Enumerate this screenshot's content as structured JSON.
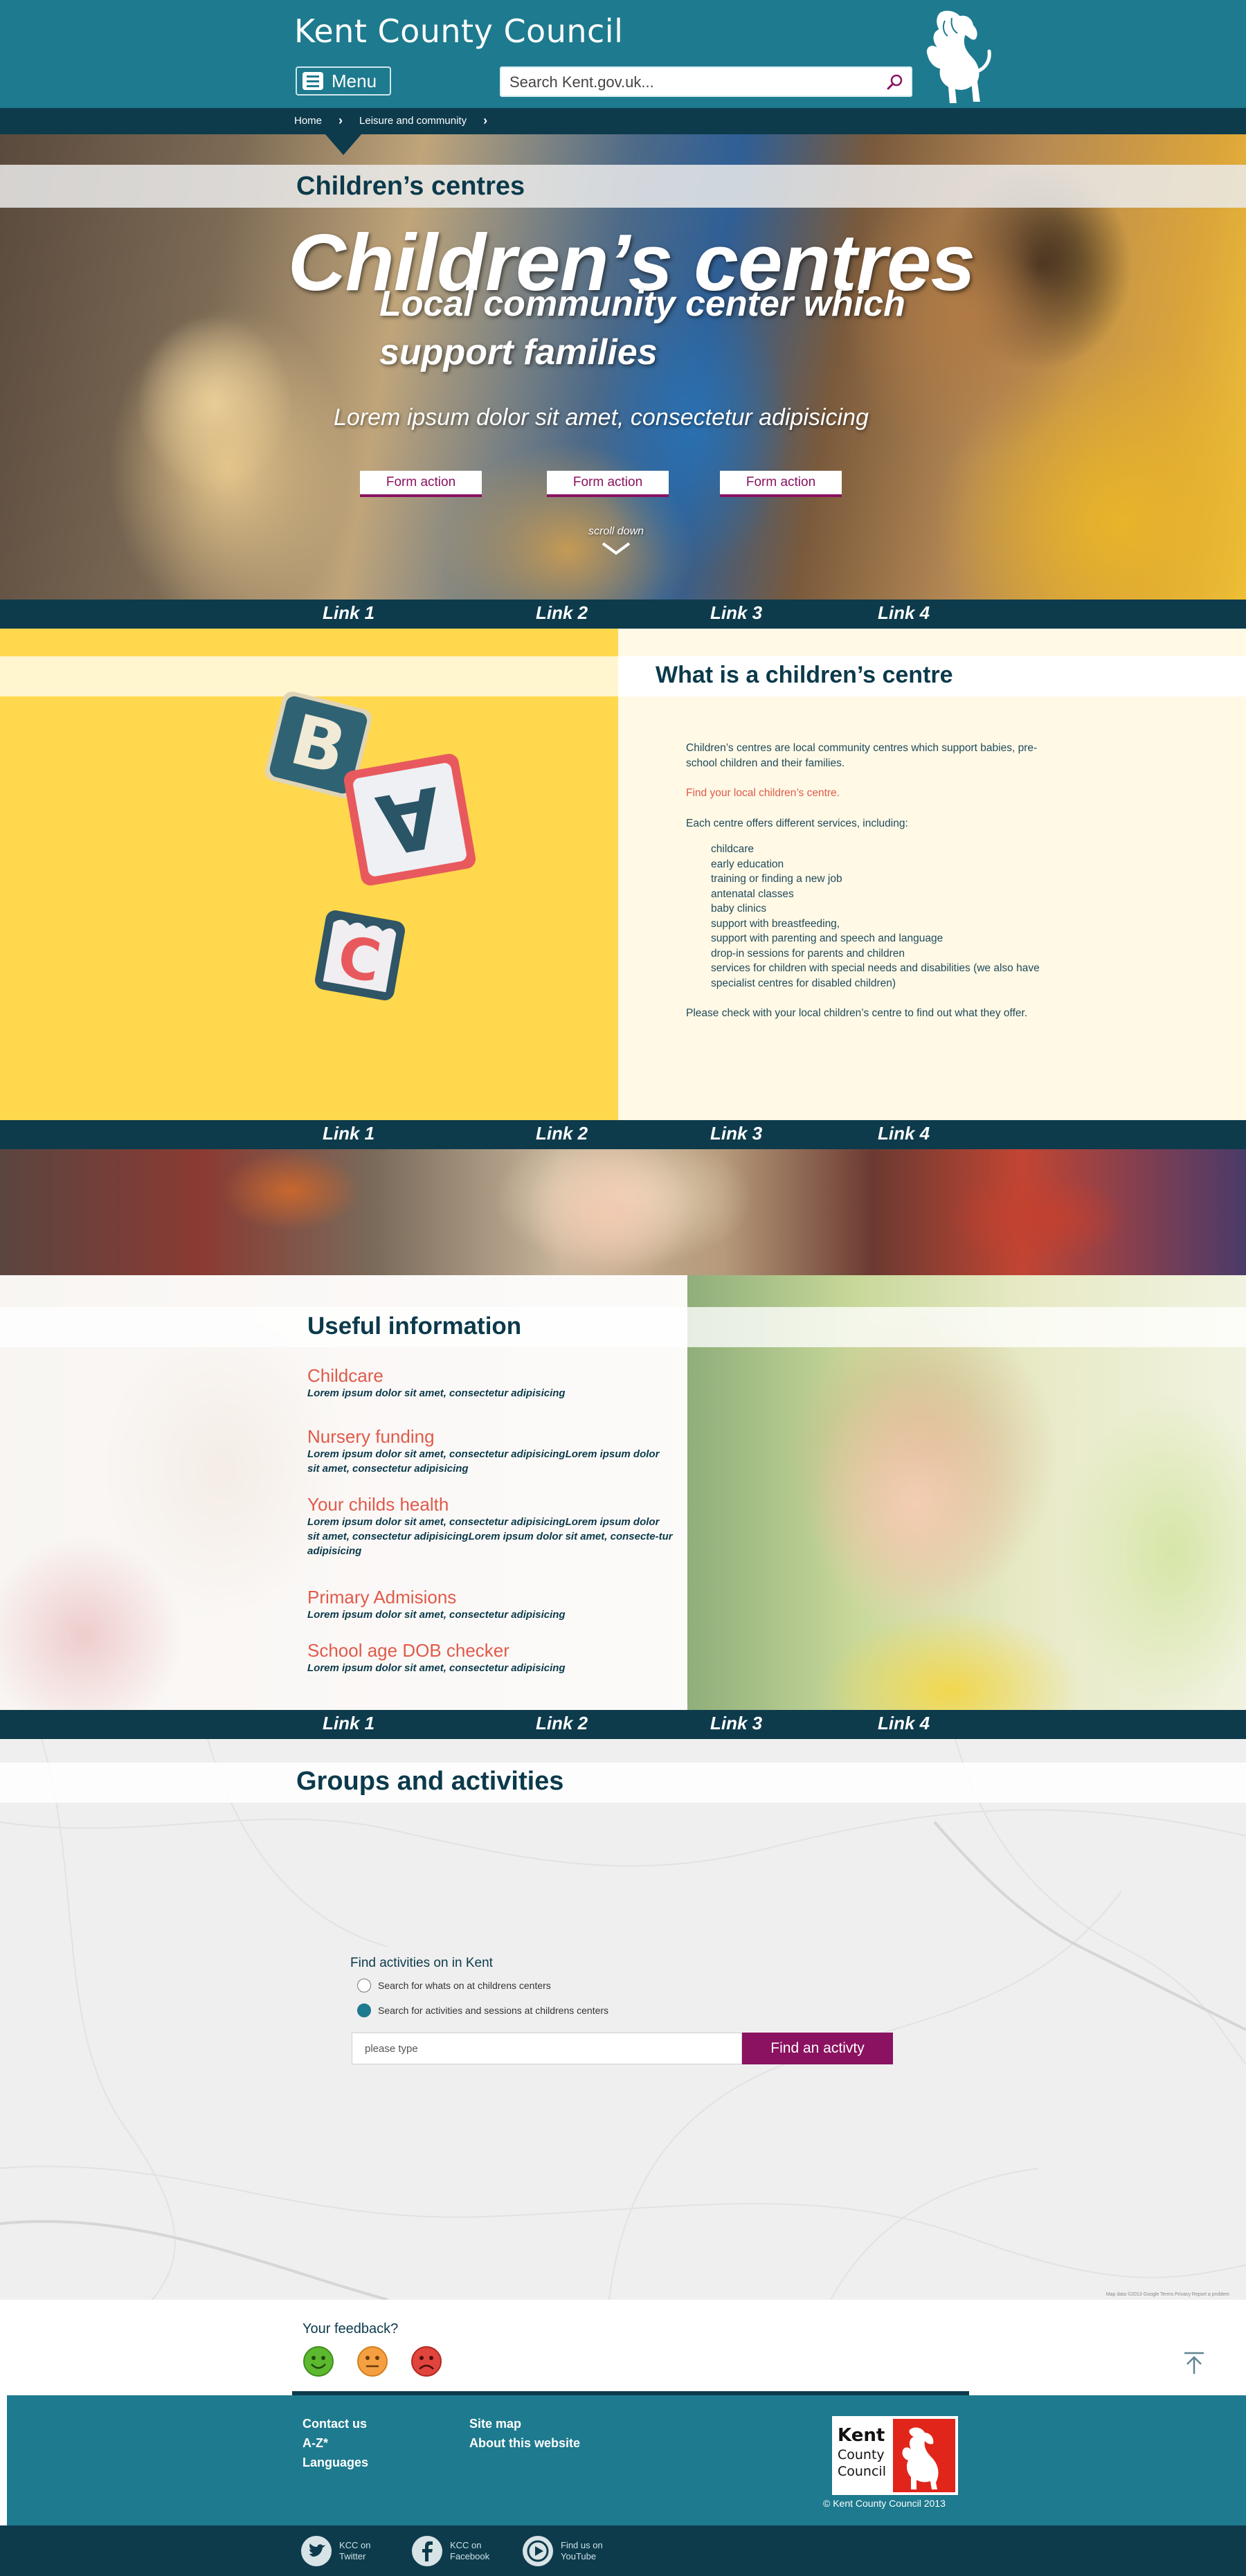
{
  "header": {
    "site_title": "Kent County Council",
    "menu_label": "Menu",
    "search_placeholder": "Search Kent.gov.uk..."
  },
  "breadcrumb": [
    "Home",
    "Leisure and community"
  ],
  "hero": {
    "band_title": "Children’s centres",
    "heading": "Children’s centres",
    "subheading": "Local community center which support families",
    "lorem": "Lorem ipsum dolor sit amet, consectetur adipisicing",
    "actions": [
      "Form action",
      "Form action",
      "Form action"
    ],
    "scroll_label": "scroll down"
  },
  "link_bar": [
    "Link 1",
    "Link 2",
    "Link 3",
    "Link 4"
  ],
  "what_is": {
    "heading": "What is a children’s centre",
    "intro": "Children’s centres are local community centres which support babies, pre-school children and their families.",
    "link": "Find your local children’s centre.",
    "services_intro": "Each centre offers different services, including:",
    "services": [
      "childcare",
      "early education",
      "training or finding a new job",
      "antenatal classes",
      "baby clinics",
      "support with breastfeeding,",
      "support with parenting and speech and language",
      "drop-in sessions for parents and children",
      "services for children with special needs and disabilities (we also have specialist centres for disabled children)"
    ],
    "outro": "Please check with your local children’s centre to find out what they offer.",
    "blocks": [
      "B",
      "A",
      "C"
    ]
  },
  "useful": {
    "heading": "Useful information",
    "items": [
      {
        "title": "Childcare",
        "desc": "Lorem ipsum dolor sit amet, consectetur adipisicing"
      },
      {
        "title": "Nursery funding",
        "desc": "Lorem ipsum dolor sit amet, consectetur adipisicingLorem ipsum dolor sit amet, consectetur adipisicing"
      },
      {
        "title": "Your childs health",
        "desc": "Lorem ipsum dolor sit amet, consectetur adipisicingLorem ipsum dolor sit amet, consectetur adipisicingLorem ipsum dolor sit amet, consecte-tur adipisicing"
      },
      {
        "title": "Primary Admisions",
        "desc": "Lorem ipsum dolor sit amet, consectetur adipisicing"
      },
      {
        "title": "School age DOB checker",
        "desc": "Lorem ipsum dolor sit amet, consectetur adipisicing"
      }
    ]
  },
  "groups": {
    "heading": "Groups and activities",
    "find_title": "Find activities on in Kent",
    "radio_options": [
      {
        "label": "Search for whats on at childrens centers",
        "selected": false
      },
      {
        "label": "Search for activities and sessions at childrens centers",
        "selected": true
      }
    ],
    "input_placeholder": "please type",
    "button_label": "Find an activty",
    "map_attribution": "Map data ©2013 Google   Terms   Privacy   Report a problem"
  },
  "feedback": {
    "label": "Your feedback?",
    "faces": [
      "happy",
      "neutral",
      "sad"
    ],
    "colors": {
      "happy": "#5cb82e",
      "neutral": "#f4a041",
      "sad": "#e0443c"
    }
  },
  "footer": {
    "col1": [
      "Contact us",
      "A-Z*",
      "Languages"
    ],
    "col2": [
      "Site map",
      "About this website"
    ],
    "logo_text": [
      "Kent",
      "County",
      "Council"
    ],
    "copyright": "© Kent County Council 2013",
    "social": [
      {
        "icon": "twitter-icon",
        "line1": "KCC on",
        "line2": "Twitter"
      },
      {
        "icon": "facebook-icon",
        "line1": "KCC on",
        "line2": "Facebook"
      },
      {
        "icon": "youtube-icon",
        "line1": "Find us on",
        "line2": "YouTube"
      }
    ]
  },
  "colors": {
    "primary": "#1e7a8e",
    "dark": "#0d3b4c",
    "accent": "#8a1260",
    "link": "#e05a4a",
    "yellow": "#ffd84d"
  }
}
